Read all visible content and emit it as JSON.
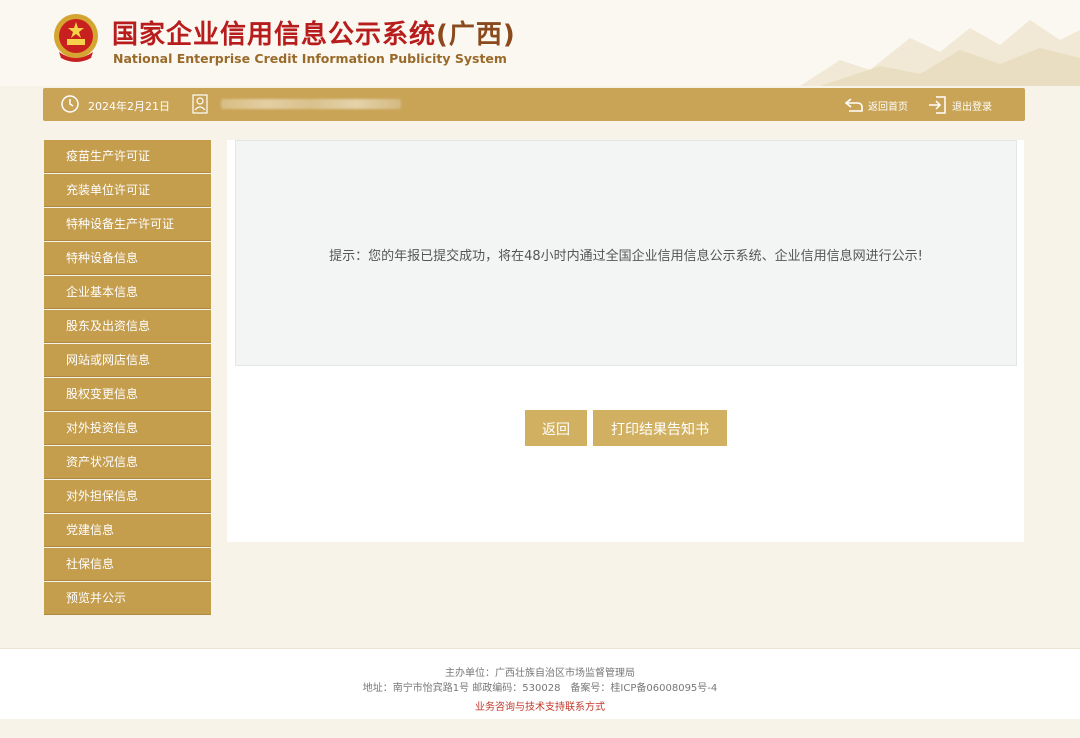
{
  "header": {
    "title_cn": "国家企业信用信息公示系统",
    "title_region": "(广西)",
    "title_en": "National Enterprise Credit Information Publicity System"
  },
  "topbar": {
    "date": "2024年2月21日",
    "home_label": "返回首页",
    "logout_label": "退出登录"
  },
  "sidebar": {
    "items": [
      {
        "label": "疫苗生产许可证"
      },
      {
        "label": "充装单位许可证"
      },
      {
        "label": "特种设备生产许可证"
      },
      {
        "label": "特种设备信息"
      },
      {
        "label": "企业基本信息"
      },
      {
        "label": "股东及出资信息"
      },
      {
        "label": "网站或网店信息"
      },
      {
        "label": "股权变更信息"
      },
      {
        "label": "对外投资信息"
      },
      {
        "label": "资产状况信息"
      },
      {
        "label": "对外担保信息"
      },
      {
        "label": "党建信息"
      },
      {
        "label": "社保信息"
      },
      {
        "label": "预览并公示"
      }
    ]
  },
  "main": {
    "notice": "提示：您的年报已提交成功，将在48小时内通过全国企业信用信息公示系统、企业信用信息网进行公示!",
    "back_button": "返回",
    "print_button": "打印结果告知书"
  },
  "footer": {
    "sponsor": "主办单位：广西壮族自治区市场监督管理局",
    "address": "地址：南宁市怡宾路1号 邮政编码：530028　备案号：桂ICP备06008095号-4",
    "support_link": "业务咨询与技术支持联系方式"
  },
  "colors": {
    "gold": "#c9a456",
    "sidebar": "#c49d4d",
    "button": "#d2b062",
    "title_red": "#b81d1d"
  },
  "icons": {
    "emblem": "national-emblem-icon",
    "clock": "clock-icon",
    "user": "user-icon",
    "home": "back-arrow-icon",
    "logout": "logout-icon"
  }
}
